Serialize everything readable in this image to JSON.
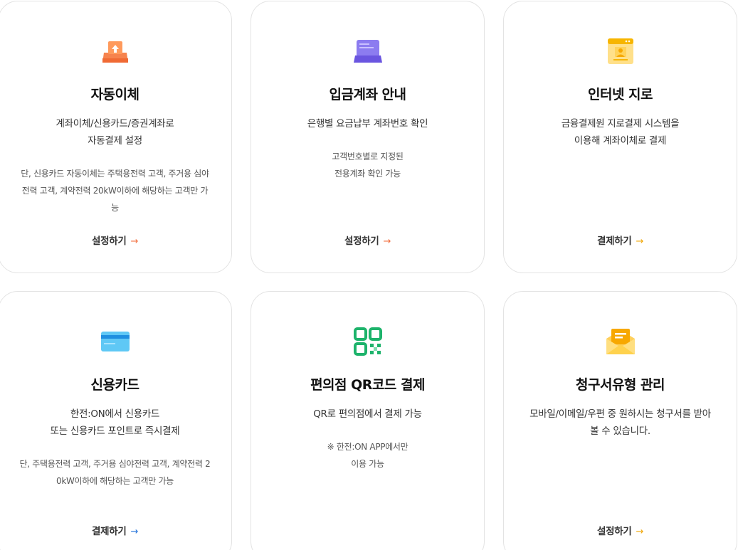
{
  "cards": [
    {
      "icon": "upload-tray-icon",
      "title": "자동이체",
      "desc": [
        "계좌이체/신용카드/증권계좌로",
        "자동결제 설정"
      ],
      "note": [
        "단, 신용카드 자동이체는 주택용전력 고객, 주거용 심야",
        "전력 고객, 계약전력 20kW이하에 해당하는 고객만 가",
        "능"
      ],
      "action": "설정하기",
      "arrow_color": "#f26b3a"
    },
    {
      "icon": "bank-book-icon",
      "title": "입금계좌 안내",
      "desc": [
        "은행별 요금납부 계좌번호 확인"
      ],
      "note": [
        "고객번호별로 지정된",
        "전용계좌 확인 가능"
      ],
      "action": "설정하기",
      "arrow_color": "#f26b3a"
    },
    {
      "icon": "web-window-icon",
      "title": "인터넷 지로",
      "desc": [
        "금융결제원 지로결제 시스템을",
        "이용해 계좌이체로 결제"
      ],
      "note": [],
      "action": "결제하기",
      "arrow_color": "#f0a500"
    },
    {
      "icon": "credit-card-icon",
      "title": "신용카드",
      "desc": [
        "한전:ON에서 신용카드",
        "또는 신용카드 포인트로 즉시결제"
      ],
      "note": [
        "단, 주택용전력 고객, 주거용 심야전력 고객, 계약전력 2",
        "0kW이하에 해당하는 고객만 가능"
      ],
      "action": "결제하기",
      "arrow_color": "#1e6fd9"
    },
    {
      "icon": "qr-code-icon",
      "title": "편의점 QR코드 결제",
      "desc": [
        "QR로 편의점에서 결제 가능"
      ],
      "note": [
        "※ 한전:ON APP에서만",
        "이용 가능"
      ],
      "action": "",
      "arrow_color": "#1e6fd9"
    },
    {
      "icon": "envelope-icon",
      "title": "청구서유형 관리",
      "desc": [
        "모바일/이메일/우편 중 원하시는 청구서를 받아",
        "볼 수 있습니다."
      ],
      "note": [],
      "action": "설정하기",
      "arrow_color": "#f0a500"
    }
  ],
  "arrow_glyph": "→"
}
